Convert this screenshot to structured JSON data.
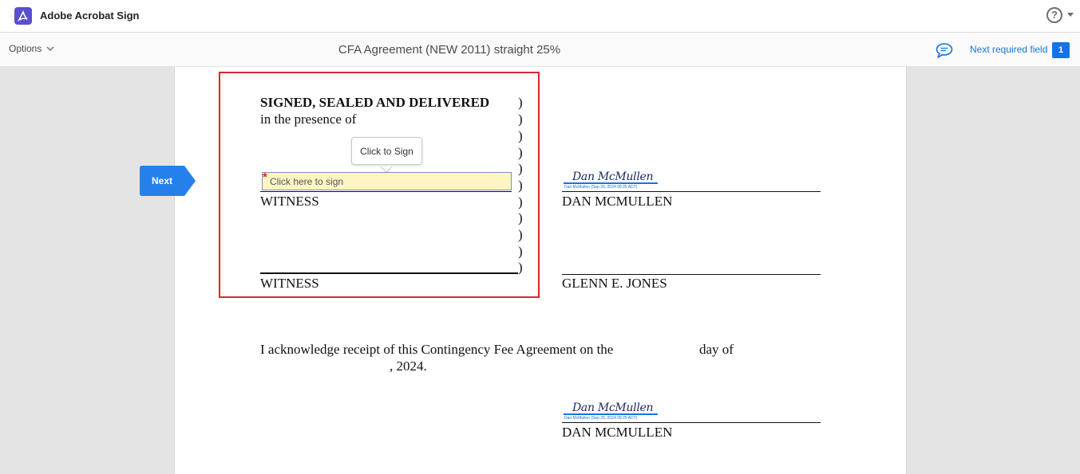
{
  "app": {
    "title": "Adobe Acrobat Sign",
    "help_symbol": "?"
  },
  "toolbar": {
    "options_label": "Options",
    "document_title": "CFA Agreement (NEW 2011) straight 25%",
    "next_required_label": "Next required field",
    "required_count": "1"
  },
  "colors": {
    "accent": "#1473e6",
    "brand": "#5a4fcf",
    "highlight_box": "#d7282f",
    "sign_field_bg": "#fdf6c3"
  },
  "icons": [
    "acrobat-sign-logo-icon",
    "help-icon",
    "chevron-down-icon",
    "comment-bubble-icon"
  ],
  "next_button": {
    "label": "Next"
  },
  "document": {
    "signed_heading": "SIGNED, SEALED AND DELIVERED",
    "presence_line": "in the presence of",
    "paren_char": ")",
    "tooltip": "Click to Sign",
    "sign_field_placeholder": "Click here to sign",
    "required_marker": "*",
    "witness_label_1": "WITNESS",
    "witness_label_2": "WITNESS",
    "signer_1_name": "DAN MCMULLEN",
    "signer_2_name": "GLENN E. JONES",
    "signature_script": "Dan McMullen",
    "signature_caption": "Dan McMullen (Sep 26, 2024 09:25 ADT)",
    "acknowledge_line_1": "I acknowledge receipt of this Contingency Fee Agreement on the",
    "acknowledge_day_of": "day of",
    "acknowledge_year": ", 2024.",
    "signer_3_name": "DAN MCMULLEN"
  }
}
